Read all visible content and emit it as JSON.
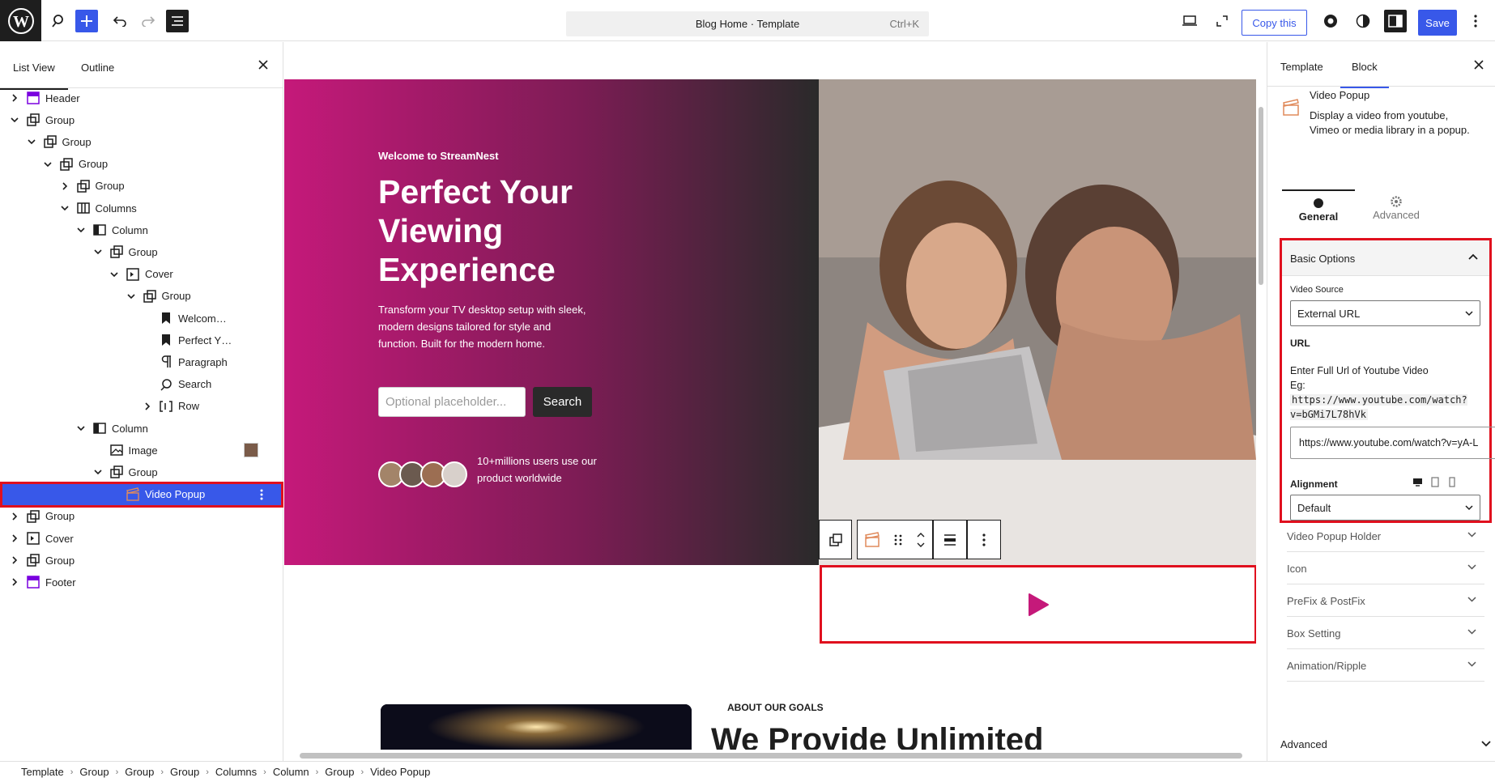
{
  "topbar": {
    "command_title": "Blog Home · Template",
    "command_shortcut": "Ctrl+K",
    "copy_label": "Copy this",
    "save_label": "Save"
  },
  "left_panel": {
    "tab_list_view": "List View",
    "tab_outline": "Outline",
    "tree": [
      {
        "label": "Header",
        "icon": "template-part-icon"
      },
      {
        "label": "Group",
        "icon": "group-icon"
      },
      {
        "label": "Group",
        "icon": "group-icon"
      },
      {
        "label": "Group",
        "icon": "group-icon"
      },
      {
        "label": "Group",
        "icon": "group-icon"
      },
      {
        "label": "Columns",
        "icon": "columns-icon"
      },
      {
        "label": "Column",
        "icon": "column-icon"
      },
      {
        "label": "Group",
        "icon": "group-icon"
      },
      {
        "label": "Cover",
        "icon": "cover-icon"
      },
      {
        "label": "Group",
        "icon": "group-icon"
      },
      {
        "label": "Welcom…",
        "icon": "bookmark-icon"
      },
      {
        "label": "Perfect Y…",
        "icon": "bookmark-icon"
      },
      {
        "label": "Paragraph",
        "icon": "paragraph-icon"
      },
      {
        "label": "Search",
        "icon": "search-icon"
      },
      {
        "label": "Row",
        "icon": "row-icon"
      },
      {
        "label": "Column",
        "icon": "column-icon"
      },
      {
        "label": "Image",
        "icon": "image-icon"
      },
      {
        "label": "Group",
        "icon": "group-icon"
      },
      {
        "label": "Video Popup",
        "icon": "video-popup-icon"
      },
      {
        "label": "Group",
        "icon": "group-icon"
      },
      {
        "label": "Cover",
        "icon": "cover-icon"
      },
      {
        "label": "Group",
        "icon": "group-icon"
      },
      {
        "label": "Footer",
        "icon": "template-part-icon"
      }
    ]
  },
  "canvas": {
    "hero_kicker": "Welcome to StreamNest",
    "hero_title": "Perfect Your Viewing Experience",
    "hero_paragraph": "Transform your TV desktop setup with sleek, modern designs tailored for style and function. Built for the modern home.",
    "search_placeholder": "Optional placeholder...",
    "search_button": "Search",
    "users_text": "10+millions users use our product worldwide",
    "about_kicker": "ABOUT OUR GOALS",
    "about_title": "We Provide Unlimited"
  },
  "right_panel": {
    "tab_template": "Template",
    "tab_block": "Block",
    "block_name": "Video Popup",
    "block_description": "Display a video from youtube, Vimeo or media library in a popup.",
    "tab_general": "General",
    "tab_advanced": "Advanced",
    "basic_options": "Basic Options",
    "video_source_label": "Video Source",
    "video_source_value": "External URL",
    "url_label": "URL",
    "url_help": "Enter Full Url of Youtube Video",
    "url_example_prefix": "Eg:",
    "url_example_code": "https://www.youtube.com/watch?v=bGMi7L78hVk",
    "url_value": "https://www.youtube.com/watch?v=yA-L",
    "alignment_label": "Alignment",
    "alignment_value": "Default",
    "sections": [
      "Video Popup Holder",
      "Icon",
      "PreFix & PostFix",
      "Box Setting",
      "Animation/Ripple"
    ],
    "advanced_label": "Advanced"
  },
  "breadcrumb": [
    "Template",
    "Group",
    "Group",
    "Group",
    "Columns",
    "Column",
    "Group",
    "Video Popup"
  ],
  "colors": {
    "accent": "#3858e9",
    "highlight": "#e0101e",
    "brand_pink": "#c5197a"
  }
}
